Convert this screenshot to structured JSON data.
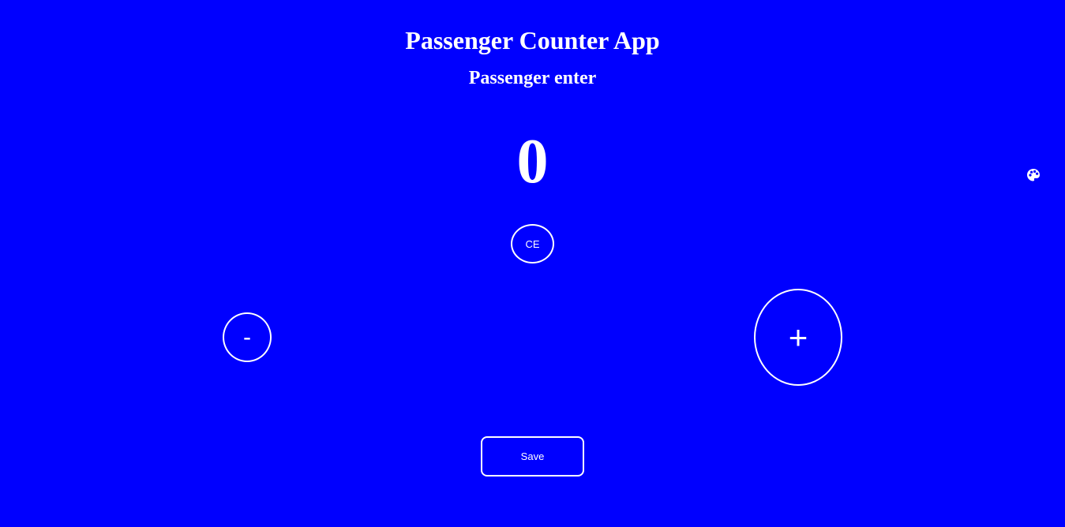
{
  "app": {
    "title": "Passenger Counter App",
    "subtitle": "Passenger enter",
    "background_color": "#0000ff",
    "foreground_color": "#ffffff"
  },
  "counter": {
    "value": "0"
  },
  "buttons": {
    "clear_label": "CE",
    "decrement_label": "-",
    "increment_label": "+",
    "save_label": "Save"
  },
  "icons": {
    "theme": "palette-icon"
  }
}
